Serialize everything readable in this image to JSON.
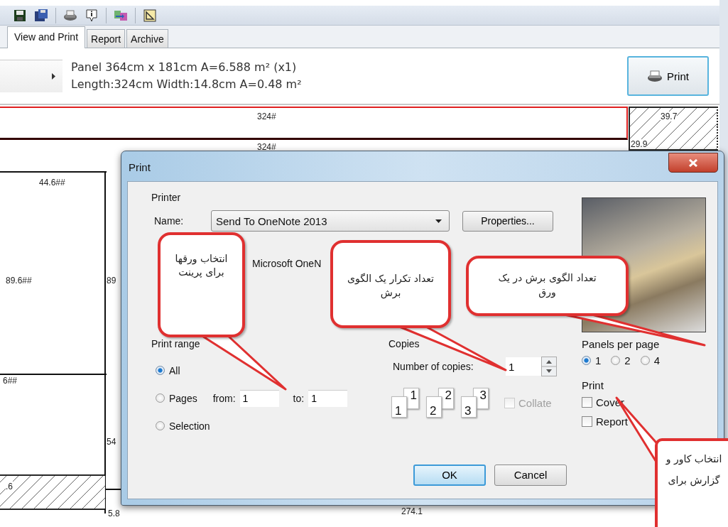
{
  "tabs": [
    {
      "label": "View and Print",
      "selected": true
    },
    {
      "label": "Report",
      "selected": false
    },
    {
      "label": "Archive",
      "selected": false
    }
  ],
  "panel_info": {
    "lines": [
      "Panel 364cm x 181cm A=6.588 m² (x1)",
      "Length:324cm Width:14.8cm A=0.48 m²"
    ]
  },
  "print_button": {
    "label": "Print"
  },
  "canvas_labels": [
    "324#",
    "324#",
    "39.7",
    "29.9",
    "44.6##",
    "89.6##",
    "89",
    "6##",
    "54",
    ".6",
    "5.8",
    "274.1"
  ],
  "dialog": {
    "title": "Print",
    "printer": {
      "heading": "Printer",
      "name_label": "Name:",
      "name_value": "Send To OneNote 2013",
      "properties_button": "Properties...",
      "type_value": "Microsoft OneN"
    },
    "print_range": {
      "heading": "Print range",
      "options": [
        {
          "label": "All",
          "selected": true
        },
        {
          "label": "Pages",
          "selected": false
        },
        {
          "label": "Selection",
          "selected": false
        }
      ],
      "from_label": "from:",
      "from_value": "1",
      "to_label": "to:",
      "to_value": "1"
    },
    "copies": {
      "heading": "Copies",
      "number_label": "Number of copies:",
      "number_value": "1",
      "collate_icons": [
        {
          "front": "1",
          "back": "1"
        },
        {
          "front": "2",
          "back": "2"
        },
        {
          "front": "3",
          "back": "3"
        }
      ],
      "collate": {
        "label": "Collate",
        "checked": false,
        "disabled": true
      }
    },
    "panels_per_page": {
      "heading": "Panels per page",
      "options": [
        {
          "label": "1",
          "selected": true
        },
        {
          "label": "2",
          "selected": false
        },
        {
          "label": "4",
          "selected": false
        }
      ]
    },
    "print_options": {
      "heading": "Print",
      "items": [
        {
          "label": "Cover",
          "checked": false
        },
        {
          "label": "Report",
          "checked": false
        }
      ]
    },
    "buttons": [
      {
        "label": "OK",
        "default": true
      },
      {
        "label": "Cancel",
        "default": false
      }
    ]
  },
  "callouts": [
    {
      "text": "تعداد الگوی برش در یک ورق"
    },
    {
      "text": "تعداد تکرار یک الگوی برش"
    },
    {
      "text": "انتخاب ورقها برای پرینت"
    },
    {
      "text": "انتخاب کاور و گزارش برای"
    }
  ]
}
